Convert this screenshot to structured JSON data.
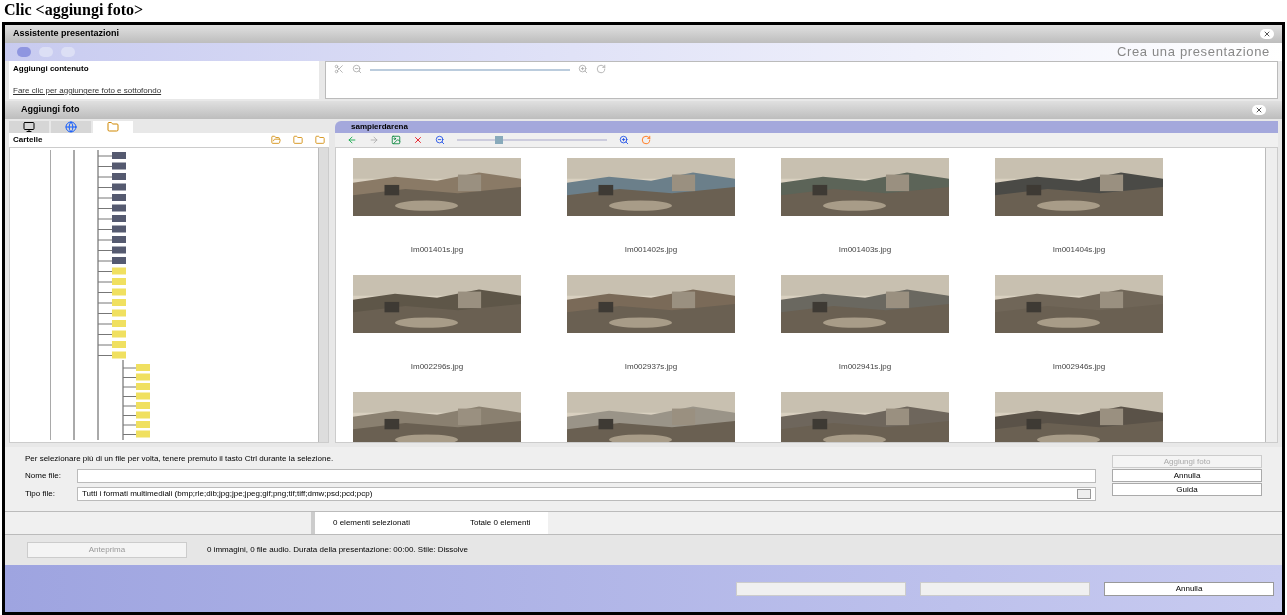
{
  "page_heading": "Clic <aggiungi foto>",
  "window": {
    "title": "Assistente presentazioni",
    "subtitle": "Crea una presentazione"
  },
  "steps": [
    {
      "selected": true
    },
    {
      "selected": false
    },
    {
      "selected": false
    }
  ],
  "content_panel": {
    "title": "Aggiungi contenuto",
    "link": "Fare clic per aggiungere foto e sottofondo"
  },
  "dialog": {
    "title": "Aggiungi foto"
  },
  "source_tabs": [
    {
      "kind": "monitor",
      "selected": false
    },
    {
      "kind": "globe",
      "selected": false
    },
    {
      "kind": "folder",
      "selected": true
    }
  ],
  "folders": {
    "title": "Cartelle"
  },
  "gallery": {
    "folder": "sampierdarena",
    "zoom": {
      "level": 0.25
    }
  },
  "photos": [
    {
      "kind": "picture",
      "name": "Im001401s.jpg"
    },
    {
      "kind": "picture",
      "name": "Im001402s.jpg"
    },
    {
      "kind": "picture",
      "name": "Im001403s.jpg"
    },
    {
      "kind": "picture",
      "name": "Im001404s.jpg"
    },
    {
      "kind": "picture",
      "name": "Im002296s.jpg"
    },
    {
      "kind": "picture",
      "name": "Im002937s.jpg"
    },
    {
      "kind": "picture",
      "name": "Im002941s.jpg"
    },
    {
      "kind": "picture",
      "name": "Im002946s.jpg"
    },
    {
      "kind": "picture"
    },
    {
      "kind": "picture"
    },
    {
      "kind": "picture"
    },
    {
      "kind": "picture"
    }
  ],
  "hint": "Per selezionare più di un file per volta, tenere premuto il tasto Ctrl durante la selezione.",
  "file_name": {
    "label": "Nome file:"
  },
  "file_type": {
    "label": "Tipo file:",
    "value": "Tutti i formati multimediali (bmp;rle;dib;jpg;jpe;jpeg;gif;png;tif;tiff;dmw;psd;pcd;pcp)"
  },
  "side_buttons": [
    {
      "label": "Aggiungi foto",
      "disabled": true
    },
    {
      "label": "Annulla",
      "disabled": false
    },
    {
      "label": "Guida",
      "disabled": false
    }
  ],
  "selection_status": {
    "selected": "0 elementi selezionati",
    "total": "Totale 0 elementi"
  },
  "preview_button": {
    "label": "Anteprima",
    "disabled": true
  },
  "summary": "0 immagini,  0 file audio. Durata della presentazione: 00:00. Stile: Dissolve",
  "footer_buttons": [
    {
      "disabled": true
    },
    {
      "disabled": true
    },
    {
      "label": "Annulla",
      "disabled": false
    }
  ]
}
